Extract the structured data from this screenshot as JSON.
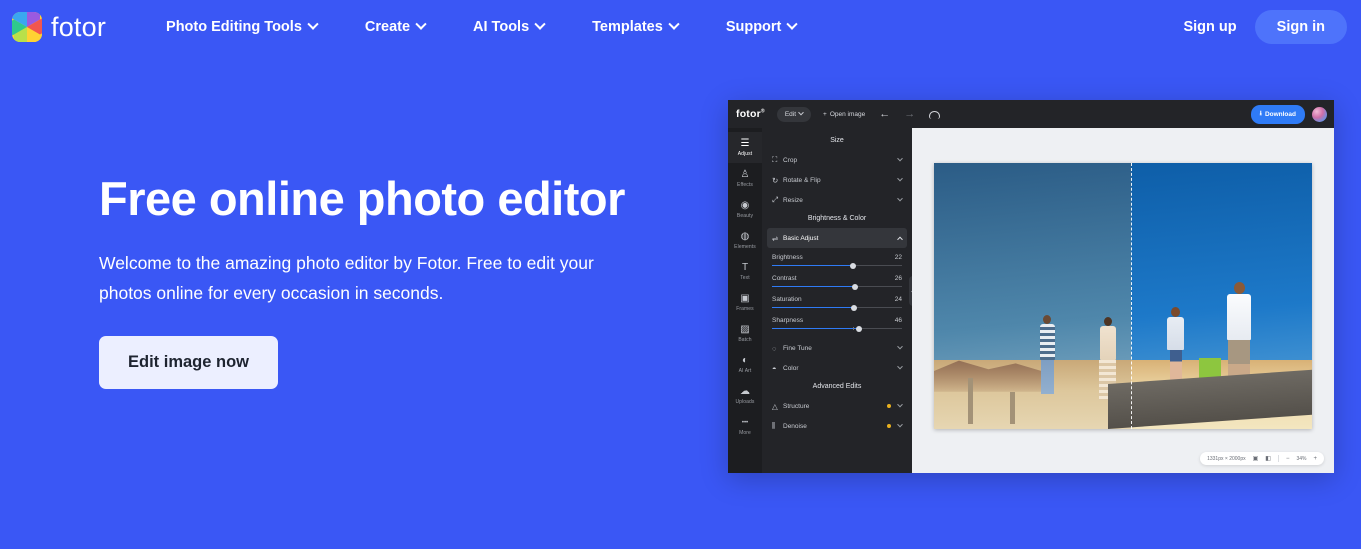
{
  "brand": {
    "name": "fotor",
    "logo_icon": "fotor-pinwheel-logo"
  },
  "nav": {
    "items": [
      {
        "label": "Photo Editing Tools",
        "caret": "chevron-down-icon"
      },
      {
        "label": "Create",
        "caret": "chevron-down-icon"
      },
      {
        "label": "AI Tools",
        "caret": "chevron-down-icon"
      },
      {
        "label": "Templates",
        "caret": "chevron-down-icon"
      },
      {
        "label": "Support",
        "caret": "chevron-down-icon"
      }
    ],
    "sign_up": "Sign up",
    "sign_in": "Sign in"
  },
  "hero": {
    "title": "Free online photo editor",
    "subtitle": "Welcome to the amazing photo editor by Fotor. Free to edit your photos online for every occasion in seconds.",
    "cta": "Edit image now"
  },
  "editor": {
    "logo": "fotor",
    "edit_menu": "Edit",
    "open_image": "Open image",
    "download": "Download",
    "back_icon": "back-arrow-icon",
    "forward_icon": "forward-arrow-icon",
    "cloud_icon": "cloud-save-icon",
    "avatar_icon": "user-avatar",
    "rail": [
      {
        "label": "Adjust",
        "glyph": "☰",
        "icon": "adjust-icon",
        "active": true
      },
      {
        "label": "Effects",
        "glyph": "♙",
        "icon": "effects-icon",
        "active": false
      },
      {
        "label": "Beauty",
        "glyph": "◉",
        "icon": "beauty-icon",
        "active": false
      },
      {
        "label": "Elements",
        "glyph": "◍",
        "icon": "elements-icon",
        "active": false
      },
      {
        "label": "Text",
        "glyph": "T",
        "icon": "text-icon",
        "active": false
      },
      {
        "label": "Frames",
        "glyph": "▣",
        "icon": "frames-icon",
        "active": false
      },
      {
        "label": "Batch",
        "glyph": "▨",
        "icon": "batch-icon",
        "active": false
      },
      {
        "label": "AI Art",
        "glyph": "◐",
        "icon": "ai-art-icon",
        "active": false
      },
      {
        "label": "Uploads",
        "glyph": "☁",
        "icon": "uploads-icon",
        "active": false
      },
      {
        "label": "More",
        "glyph": "•••",
        "icon": "more-icon",
        "active": false
      }
    ],
    "panel": {
      "size_heading": "Size",
      "size_rows": [
        {
          "label": "Crop",
          "icon": "crop-icon"
        },
        {
          "label": "Rotate & Flip",
          "icon": "rotate-flip-icon"
        },
        {
          "label": "Resize",
          "icon": "resize-icon"
        }
      ],
      "color_heading": "Brightness & Color",
      "basic_adjust": {
        "label": "Basic Adjust",
        "icon": "sliders-icon"
      },
      "sliders": [
        {
          "name": "Brightness",
          "value": "22",
          "pct": 62
        },
        {
          "name": "Contrast",
          "value": "26",
          "pct": 64
        },
        {
          "name": "Saturation",
          "value": "24",
          "pct": 63
        },
        {
          "name": "Sharpness",
          "value": "46",
          "pct": 67
        }
      ],
      "more_rows": [
        {
          "label": "Fine Tune",
          "icon": "fine-tune-icon"
        },
        {
          "label": "Color",
          "icon": "color-icon"
        }
      ],
      "advanced_heading": "Advanced Edits",
      "advanced_rows": [
        {
          "label": "Structure",
          "icon": "structure-icon",
          "pro": true
        },
        {
          "label": "Denoise",
          "icon": "denoise-icon",
          "pro": true
        }
      ],
      "collapse_icon": "collapse-panel-icon"
    },
    "status": {
      "dimensions": "1331px × 2000px",
      "fit_icon": "fit-screen-icon",
      "compare_icon": "compare-icon",
      "zoom_out": "−",
      "zoom_level": "34%",
      "zoom_in": "+"
    }
  },
  "colors": {
    "page_bg": "#3a57f5",
    "signin_bg": "#4e73fb",
    "cta_bg": "#ecefff",
    "editor_bg": "#1f2023",
    "accent_blue": "#2f7bf6",
    "pro_dot": "#e8b020"
  }
}
